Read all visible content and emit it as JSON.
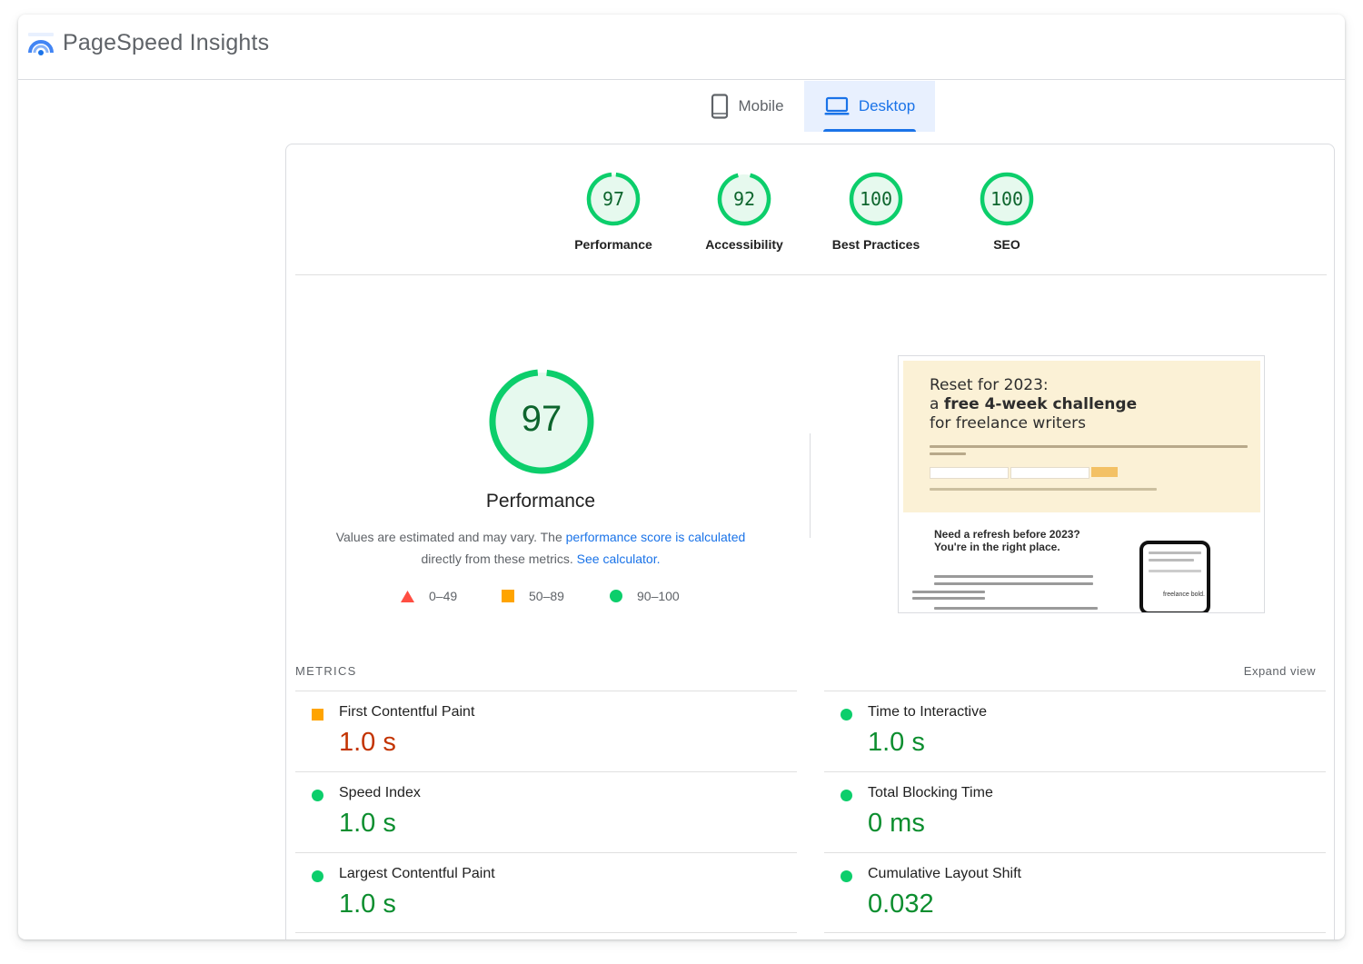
{
  "app": {
    "title": "PageSpeed Insights",
    "logo_icon": "pagespeed-logo-icon"
  },
  "tabs": [
    {
      "label": "Mobile",
      "icon": "phone-icon",
      "selected": false
    },
    {
      "label": "Desktop",
      "icon": "laptop-icon",
      "selected": true
    }
  ],
  "categories": [
    {
      "label": "Performance",
      "score": "97"
    },
    {
      "label": "Accessibility",
      "score": "92"
    },
    {
      "label": "Best Practices",
      "score": "100"
    },
    {
      "label": "SEO",
      "score": "100"
    }
  ],
  "performance": {
    "score": "97",
    "title": "Performance",
    "desc_prefix": "Values are estimated and may vary. The ",
    "desc_link1": "performance score is calculated",
    "desc_middle": " directly from these metrics. ",
    "desc_link2": "See calculator."
  },
  "legend": [
    {
      "range": "0–49",
      "shape": "triangle",
      "color": "#ff4e42"
    },
    {
      "range": "50–89",
      "shape": "square",
      "color": "#ffa400"
    },
    {
      "range": "90–100",
      "shape": "circle",
      "color": "#0cce6b"
    }
  ],
  "screenshot": {
    "headline_l1": "Reset for 2023:",
    "headline_l2_pre": "a ",
    "headline_l2_bold": "free 4-week challenge",
    "headline_l3": "for freelance writers",
    "sub": "Need a refresh before 2023? You're in the right place.",
    "phone_text": "freelance bold."
  },
  "metrics": {
    "heading": "METRICS",
    "expand_label": "Expand view",
    "items": [
      {
        "name": "First Contentful Paint",
        "value": "1.0 s",
        "rating": "average"
      },
      {
        "name": "Time to Interactive",
        "value": "1.0 s",
        "rating": "good"
      },
      {
        "name": "Speed Index",
        "value": "1.0 s",
        "rating": "good"
      },
      {
        "name": "Total Blocking Time",
        "value": "0 ms",
        "rating": "good"
      },
      {
        "name": "Largest Contentful Paint",
        "value": "1.0 s",
        "rating": "good"
      },
      {
        "name": "Cumulative Layout Shift",
        "value": "0.032",
        "rating": "good"
      }
    ]
  },
  "colors": {
    "accent": "#1a73e8",
    "pass": "#0cce6b",
    "pass_text": "#0c8e2f",
    "average": "#ffa400",
    "average_text": "#c33300",
    "fail": "#ff4e42"
  }
}
